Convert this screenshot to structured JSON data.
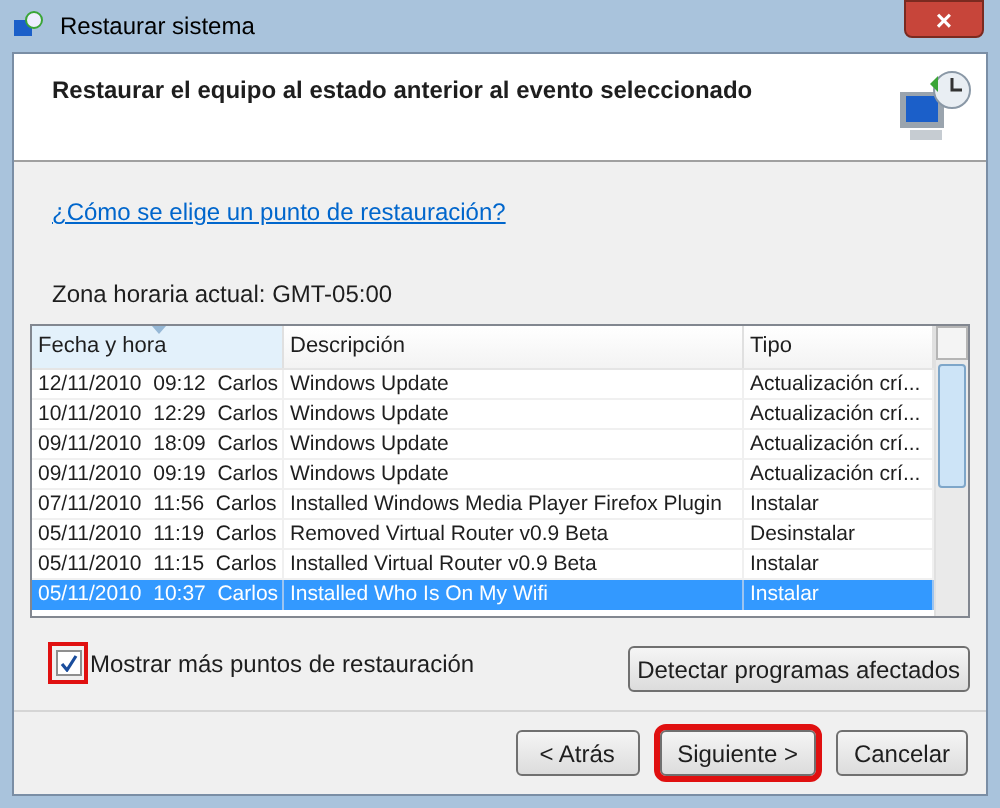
{
  "window": {
    "title": "Restaurar sistema",
    "close": "×"
  },
  "header": {
    "title": "Restaurar el equipo al estado anterior al evento seleccionado"
  },
  "help_link": "¿Cómo se elige un punto de restauración?",
  "timezone": "Zona horaria actual: GMT-05:00",
  "table": {
    "columns": [
      {
        "label": "Fecha y hora",
        "sorted": true
      },
      {
        "label": "Descripción",
        "sorted": false
      },
      {
        "label": "Tipo",
        "sorted": false
      }
    ],
    "rows": [
      {
        "date": "12/11/2010  09:12  Carlos",
        "description": "Windows Update",
        "type": "Actualización crí...",
        "selected": false
      },
      {
        "date": "10/11/2010  12:29  Carlos",
        "description": "Windows Update",
        "type": "Actualización crí...",
        "selected": false
      },
      {
        "date": "09/11/2010  18:09  Carlos",
        "description": "Windows Update",
        "type": "Actualización crí...",
        "selected": false
      },
      {
        "date": "09/11/2010  09:19  Carlos",
        "description": "Windows Update",
        "type": "Actualización crí...",
        "selected": false
      },
      {
        "date": "07/11/2010  11:56  Carlos",
        "description": "Installed Windows Media Player Firefox Plugin",
        "type": "Instalar",
        "selected": false
      },
      {
        "date": "05/11/2010  11:19  Carlos",
        "description": "Removed Virtual Router v0.9 Beta",
        "type": "Desinstalar",
        "selected": false
      },
      {
        "date": "05/11/2010  11:15  Carlos",
        "description": "Installed Virtual Router v0.9 Beta",
        "type": "Instalar",
        "selected": false
      },
      {
        "date": "05/11/2010  10:37  Carlos",
        "description": "Installed Who Is On My Wifi",
        "type": "Instalar",
        "selected": true
      }
    ]
  },
  "show_more": {
    "label": "Mostrar más puntos de restauración",
    "checked": true,
    "highlighted": true
  },
  "detect_button": "Detectar programas afectados",
  "buttons": [
    {
      "label": "< Atrás",
      "highlighted": false
    },
    {
      "label": "Siguiente >",
      "highlighted": true
    },
    {
      "label": "Cancelar",
      "highlighted": false
    }
  ]
}
